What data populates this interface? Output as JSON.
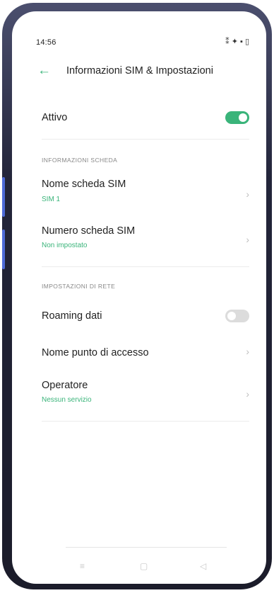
{
  "status_bar": {
    "time": "14:56",
    "icons": "⁑ ✦ ▪ ▯"
  },
  "header": {
    "back_glyph": "←",
    "title": "Informazioni SIM & Impostazioni"
  },
  "active_row": {
    "label": "Attivo",
    "toggle_on": true
  },
  "card_info": {
    "section_label": "INFORMAZIONI SCHEDA",
    "sim_name": {
      "label": "Nome scheda SIM",
      "value": "SIM 1"
    },
    "sim_number": {
      "label": "Numero scheda SIM",
      "value": "Non impostato"
    }
  },
  "network": {
    "section_label": "IMPOSTAZIONI DI RETE",
    "roaming": {
      "label": "Roaming dati",
      "toggle_on": false
    },
    "apn": {
      "label": "Nome punto di accesso"
    },
    "operator": {
      "label": "Operatore",
      "value": "Nessun servizio"
    }
  },
  "nav": {
    "menu_glyph": "≡",
    "home_glyph": "▢",
    "back_glyph": "◁"
  },
  "colors": {
    "accent": "#3ab47a",
    "toggle_off": "#dcdcdc",
    "device_frame": "#1b1c2a",
    "side_buttons": "#4d6ad8"
  }
}
